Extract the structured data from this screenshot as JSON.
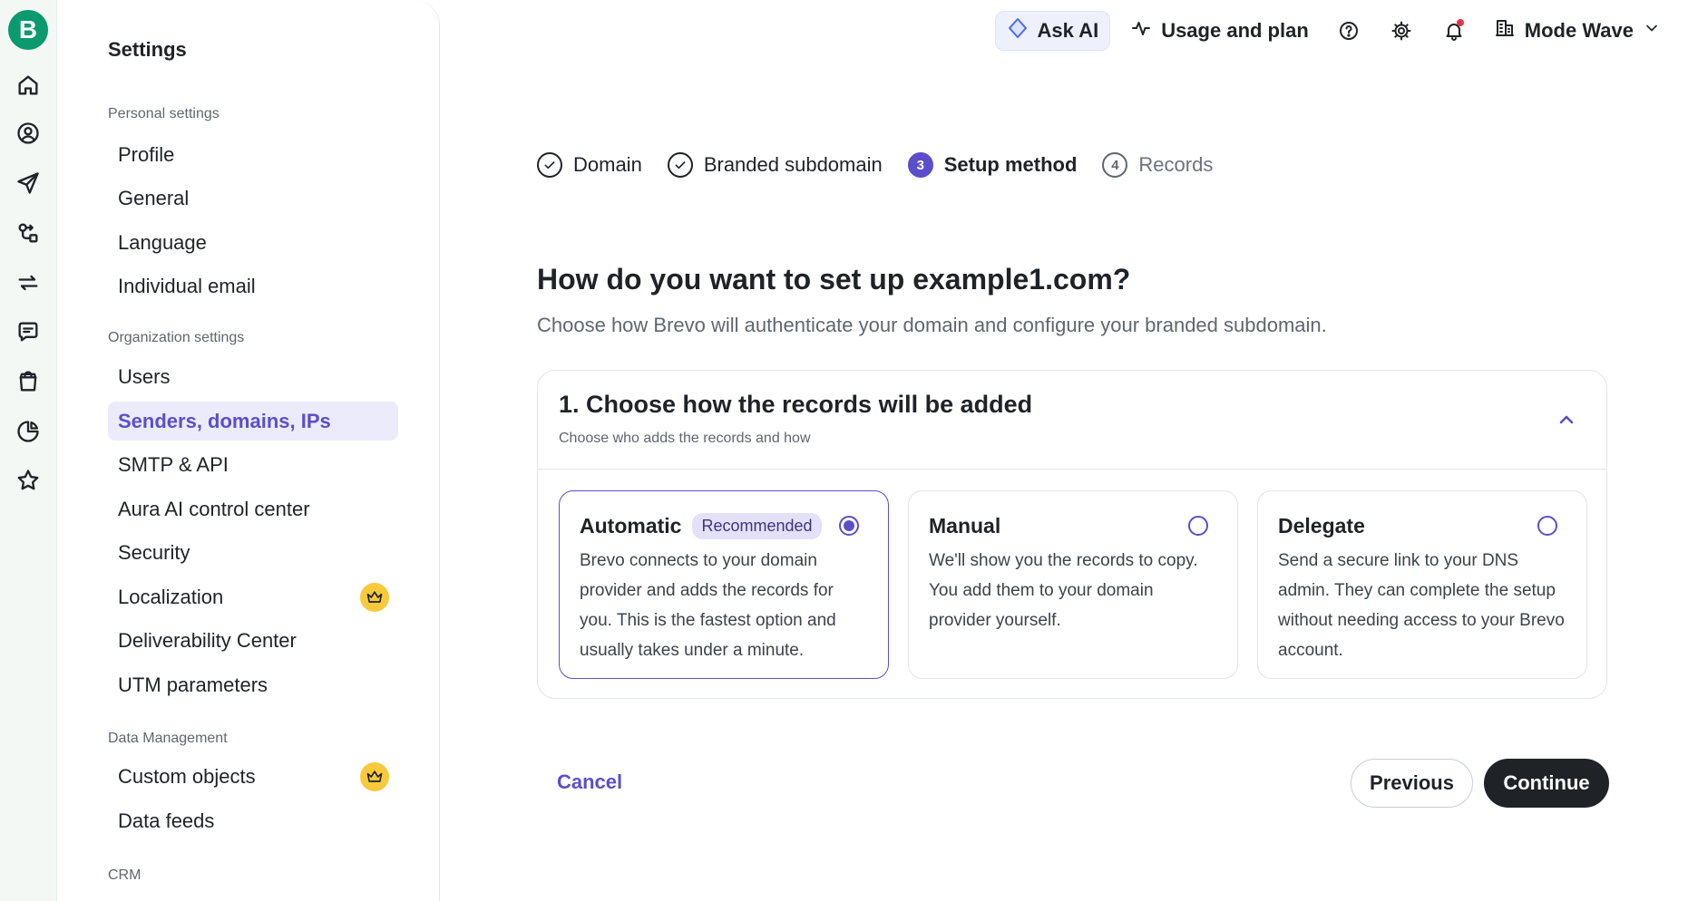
{
  "app": {
    "logo_letter": "B",
    "brand_color": "#0b996e",
    "accent_color": "#5b4fc9"
  },
  "rail": {
    "icons": [
      "home-icon",
      "contacts-icon",
      "campaigns-icon",
      "automations-icon",
      "sync-icon",
      "conversations-icon",
      "ecommerce-icon",
      "reports-icon",
      "favorites-icon"
    ]
  },
  "sidebar": {
    "title": "Settings",
    "sections": [
      {
        "label": "Personal settings",
        "items": [
          "Profile",
          "General",
          "Language",
          "Individual email"
        ]
      },
      {
        "label": "Organization settings",
        "items": [
          "Users",
          "Senders, domains, IPs",
          "SMTP & API",
          "Aura AI control center",
          "Security",
          "Localization",
          "Deliverability Center",
          "UTM parameters"
        ]
      },
      {
        "label": "Data Management",
        "items": [
          "Custom objects",
          "Data feeds"
        ]
      },
      {
        "label": "CRM",
        "items": []
      }
    ],
    "active_item": "Senders, domains, IPs"
  },
  "header": {
    "ask_ai": "Ask AI",
    "usage": "Usage and plan",
    "account": "Mode Wave",
    "icons": [
      "help-icon",
      "gear-icon",
      "bell-icon"
    ]
  },
  "stepper": {
    "steps": [
      {
        "label": "Domain",
        "state": "done",
        "number": "1"
      },
      {
        "label": "Branded subdomain",
        "state": "done",
        "number": "2"
      },
      {
        "label": "Setup method",
        "state": "current",
        "number": "3"
      },
      {
        "label": "Records",
        "state": "pending",
        "number": "4"
      }
    ]
  },
  "main": {
    "heading": "How do you want to set up example1.com?",
    "subheading": "Choose how Brevo will authenticate your domain and configure your branded subdomain."
  },
  "panel": {
    "title": "1. Choose how the records will be added",
    "subtitle": "Choose who adds the records and how",
    "options": [
      {
        "title": "Automatic",
        "badge": "Recommended",
        "selected": true,
        "description": "Brevo connects to your domain provider and adds the records for you. This is the fastest option and usually takes under a minute."
      },
      {
        "title": "Manual",
        "badge": "",
        "selected": false,
        "description": "We'll show you the records to copy. You add them to your domain provider yourself."
      },
      {
        "title": "Delegate",
        "badge": "",
        "selected": false,
        "description": "Send a secure link to your DNS admin. They can complete the setup without needing access to your Brevo account."
      }
    ]
  },
  "footer": {
    "cancel": "Cancel",
    "previous": "Previous",
    "continue": "Continue"
  }
}
